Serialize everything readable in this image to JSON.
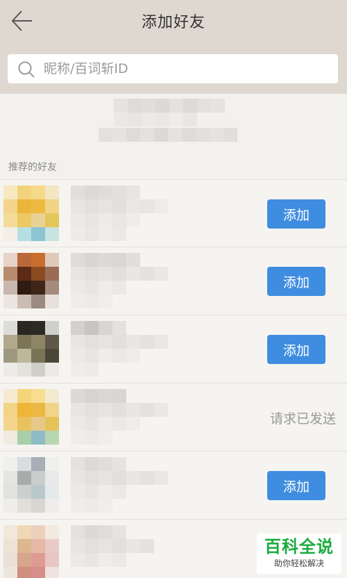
{
  "header": {
    "title": "添加好友",
    "back_icon": "arrow-left-icon"
  },
  "search": {
    "placeholder": "昵称/百词斩ID",
    "icon": "search-icon"
  },
  "section": {
    "label": "推荐的好友"
  },
  "friends": [
    {
      "action": "add",
      "action_label": "添加"
    },
    {
      "action": "add",
      "action_label": "添加"
    },
    {
      "action": "add",
      "action_label": "添加"
    },
    {
      "action": "sent",
      "action_label": "请求已发送"
    },
    {
      "action": "add",
      "action_label": "添加"
    },
    {
      "action": "none",
      "action_label": ""
    }
  ],
  "watermark": {
    "main": "百科全说",
    "sub": "助你轻松解决"
  },
  "colors": {
    "header_bg": "#dfd8d0",
    "page_bg": "#f3f1ee",
    "button_blue": "#3f8de0",
    "watermark_green": "#1aab3c"
  }
}
